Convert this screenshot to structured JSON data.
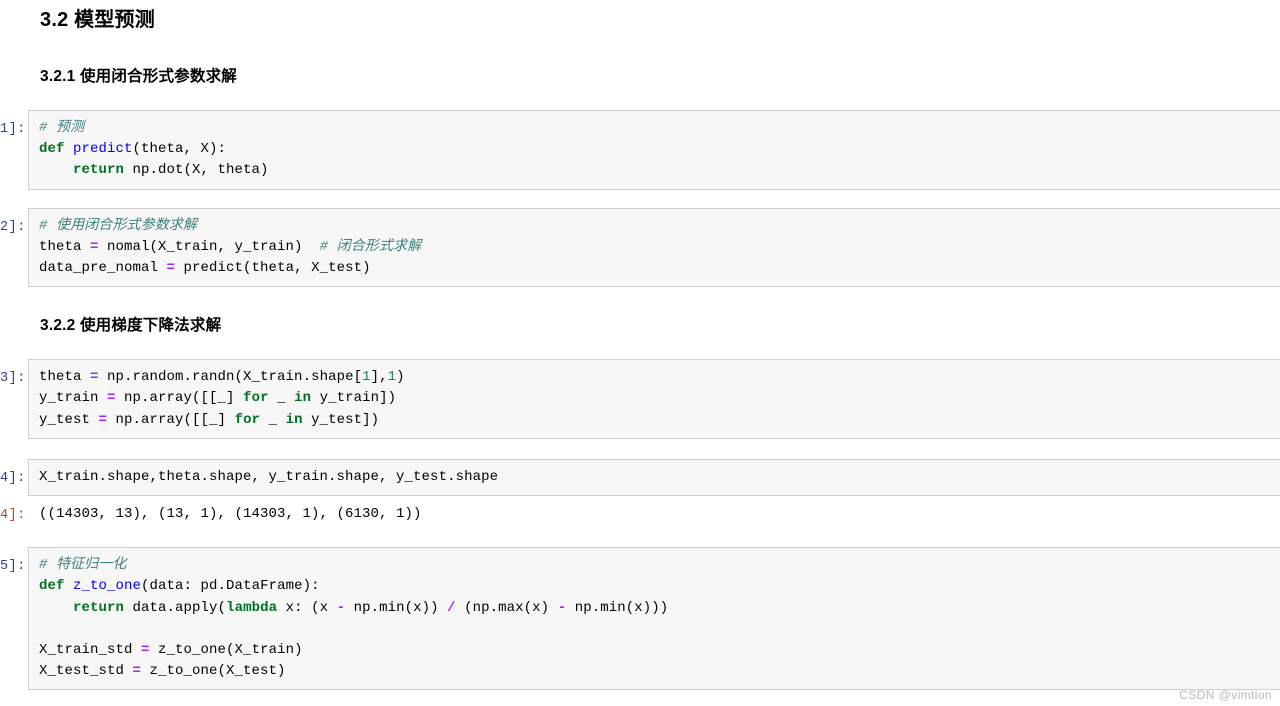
{
  "document": {
    "heading_main": "3.2 模型预测",
    "heading_sub_1": "3.2.1 使用闭合形式参数求解",
    "heading_sub_2": "3.2.2 使用梯度下降法求解"
  },
  "prompts": {
    "in_1": "1]:",
    "in_2": "2]:",
    "in_3": "3]:",
    "in_4": "4]:",
    "out_4": "4]:",
    "in_5": "5]:"
  },
  "cells": {
    "cell1": {
      "line1_comment": "# 预测",
      "line2_kw": "def",
      "line2_fn": "predict",
      "line2_rest": "(theta, X):",
      "line3_kw": "return",
      "line3_rest": " np.dot(X, theta)"
    },
    "cell2": {
      "line1_comment": "# 使用闭合形式参数求解",
      "line2_name": "theta ",
      "line2_op": "=",
      "line2_rest": " nomal(X_train, y_train)",
      "line2_trail_comment": "# 闭合形式求解",
      "line3_name": "data_pre_nomal ",
      "line3_op": "=",
      "line3_rest": " predict(theta, X_test)"
    },
    "cell3": {
      "l1_a": "theta ",
      "l1_op": "=",
      "l1_b": " np.random.randn(X_train.shape[",
      "l1_n1": "1",
      "l1_c": "],",
      "l1_n2": "1",
      "l1_d": ")",
      "l2_a": "y_train ",
      "l2_op": "=",
      "l2_b": " np.array([[_] ",
      "l2_kw1": "for",
      "l2_c": " _ ",
      "l2_kw2": "in",
      "l2_d": " y_train])",
      "l3_a": "y_test ",
      "l3_op": "=",
      "l3_b": " np.array([[_] ",
      "l3_kw1": "for",
      "l3_c": " _ ",
      "l3_kw2": "in",
      "l3_d": " y_test])"
    },
    "cell4": {
      "line1": "X_train.shape,theta.shape, y_train.shape, y_test.shape",
      "output": "((14303, 13), (13, 1), (14303, 1), (6130, 1))"
    },
    "cell5": {
      "l1_comment": "# 特征归一化",
      "l2_kw": "def",
      "l2_fn": "z_to_one",
      "l2_rest": "(data: pd.DataFrame):",
      "l3_kw": "return",
      "l3_a": " data.apply(",
      "l3_kw2": "lambda",
      "l3_b": " x: (x ",
      "l3_op1": "-",
      "l3_c": " np.min(x)) ",
      "l3_op2": "/",
      "l3_d": " (np.max(x) ",
      "l3_op3": "-",
      "l3_e": " np.min(x)))",
      "l4_blank": "",
      "l5_a": "X_train_std ",
      "l5_op": "=",
      "l5_b": " z_to_one(X_train)",
      "l6_a": "X_test_std ",
      "l6_op": "=",
      "l6_b": " z_to_one(X_test)"
    }
  },
  "watermark": {
    "text": "CSDN @vimtion"
  },
  "colors": {
    "cell_background": "#f7f7f7",
    "cell_border": "#cfcfcf",
    "in_prompt": "#303F9F",
    "out_prompt": "#D84315",
    "comment": "#408080",
    "keyword": "#007020",
    "function_name": "#0000FF",
    "operator": "#AA22FF",
    "number": "#208050",
    "watermark": "#b9b9b9"
  }
}
